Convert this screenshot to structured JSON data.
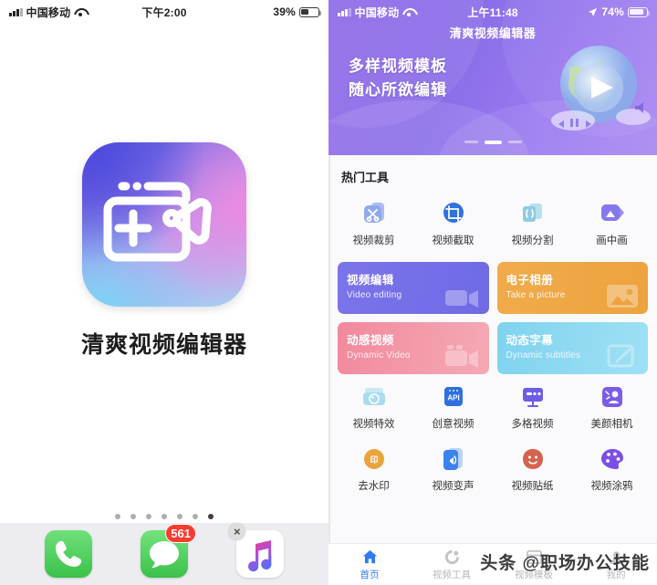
{
  "left_screen": {
    "status_bar": {
      "carrier": "中国移动",
      "wifi_icon": "wifi-icon",
      "time": "下午2:00",
      "battery_percent": "39%",
      "battery_icon": "battery-icon",
      "signal_icon": "signal-bars-icon"
    },
    "app": {
      "icon_name": "qingshuang-video-editor-app-icon",
      "name": "清爽视频编辑器"
    },
    "page_dots": {
      "count": 7,
      "active_index": 6
    },
    "dock": [
      {
        "name": "Phone",
        "icon": "phone-icon",
        "badge": null
      },
      {
        "name": "Messages",
        "icon": "messages-icon",
        "badge": "561"
      },
      {
        "name": "Music",
        "icon": "music-icon",
        "badge": null,
        "delete_badge": "×"
      }
    ]
  },
  "right_screen": {
    "status_bar": {
      "carrier": "中国移动",
      "wifi_icon": "wifi-icon",
      "time": "上午11:48",
      "location_icon": "location-arrow-icon",
      "battery_percent": "74%",
      "battery_icon": "battery-icon",
      "signal_icon": "signal-bars-icon"
    },
    "banner": {
      "title": "清爽视频编辑器",
      "line1": "多样视频模板",
      "line2": "随心所欲编辑",
      "illustration": "globe-play-button-illustration",
      "indicators": {
        "count": 3,
        "active_index": 1
      }
    },
    "hot_tools": {
      "section_title": "热门工具",
      "items": [
        {
          "label": "视频裁剪",
          "icon": "scissors-icon"
        },
        {
          "label": "视频截取",
          "icon": "crop-icon"
        },
        {
          "label": "视频分割",
          "icon": "split-icon"
        },
        {
          "label": "画中画",
          "icon": "picture-in-picture-icon"
        }
      ]
    },
    "feature_cards": [
      {
        "title": "视频编辑",
        "subtitle": "Video editing",
        "color": "#6f6be6",
        "art": "video-camera-icon"
      },
      {
        "title": "电子相册",
        "subtitle": "Take a picture",
        "color": "#eda33f",
        "art": "photo-icon"
      },
      {
        "title": "动感视频",
        "subtitle": "Dynamic Video",
        "color": "#f2899c",
        "art": "video-camera-icon"
      },
      {
        "title": "动态字幕",
        "subtitle": "Dynamic subtitles",
        "color": "#7fd3ef",
        "art": "subtitle-icon"
      }
    ],
    "tool_grid_row2": [
      {
        "label": "视频特效",
        "icon": "palette-effects-icon"
      },
      {
        "label": "创意视频",
        "icon": "api-icon"
      },
      {
        "label": "多格视频",
        "icon": "monitor-grid-icon"
      },
      {
        "label": "美颜相机",
        "icon": "beauty-camera-icon"
      }
    ],
    "tool_grid_row3": [
      {
        "label": "去水印",
        "icon": "watermark-remove-icon"
      },
      {
        "label": "视频变声",
        "icon": "voice-change-icon"
      },
      {
        "label": "视频贴纸",
        "icon": "sticker-smiley-icon"
      },
      {
        "label": "视频涂鸦",
        "icon": "paint-palette-icon"
      }
    ],
    "tab_bar": [
      {
        "label": "首页",
        "icon": "home-icon",
        "active": true
      },
      {
        "label": "视频工具",
        "icon": "tools-icon",
        "active": false
      },
      {
        "label": "视频模板",
        "icon": "template-icon",
        "active": false
      },
      {
        "label": "我的",
        "icon": "user-icon",
        "active": false
      }
    ]
  },
  "watermark": {
    "text": "头条 @职场办公技能"
  },
  "colors": {
    "accent_blue": "#2f7bf6",
    "banner_purple": "#8f6ae8",
    "badge_red": "#fa3b2f"
  }
}
